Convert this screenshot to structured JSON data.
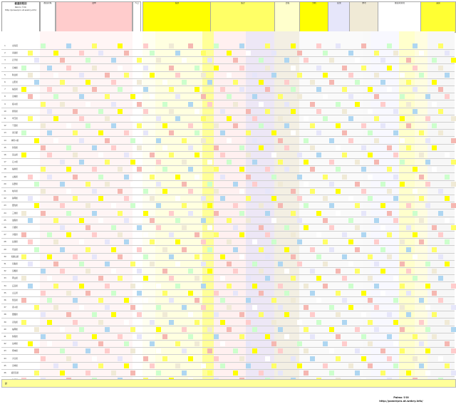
{
  "sheet": {
    "title_block": {
      "title": "都道府県別",
      "author": "Palmo ©Oi",
      "url": "http://powerpro.at.webry.info/"
    },
    "headers": [
      {
        "label": "都道府県",
        "color": "#ffffff"
      },
      {
        "label": "選挙",
        "color": "#ffcccc"
      },
      {
        "label": "人口",
        "color": "#ffffff"
      },
      {
        "label": "投票",
        "color": "#ffff00"
      },
      {
        "label": "集計",
        "color": "#ffff66"
      },
      {
        "label": "比較",
        "color": "#ffffcc"
      },
      {
        "label": "分析",
        "color": "#ffff00"
      },
      {
        "label": "結果",
        "color": "#e6e6fa"
      },
      {
        "label": "参考",
        "color": "#f0ead6"
      },
      {
        "label": "都道府県別",
        "color": "#ffffff"
      },
      {
        "label": "議席",
        "color": "#ffff33"
      }
    ],
    "rows": [
      {
        "no": "1",
        "pref": "北海道"
      },
      {
        "no": "2",
        "pref": "青森県"
      },
      {
        "no": "3",
        "pref": "岩手県"
      },
      {
        "no": "4",
        "pref": "宮城県"
      },
      {
        "no": "5",
        "pref": "秋田県"
      },
      {
        "no": "6",
        "pref": "山形県"
      },
      {
        "no": "7",
        "pref": "福島県"
      },
      {
        "no": "8",
        "pref": "茨城県"
      },
      {
        "no": "9",
        "pref": "栃木県"
      },
      {
        "no": "10",
        "pref": "群馬県"
      },
      {
        "no": "11",
        "pref": "埼玉県"
      },
      {
        "no": "12",
        "pref": "千葉県"
      },
      {
        "no": "13",
        "pref": "東京都"
      },
      {
        "no": "14",
        "pref": "神奈川県"
      },
      {
        "no": "15",
        "pref": "新潟県"
      },
      {
        "no": "16",
        "pref": "富山県"
      },
      {
        "no": "17",
        "pref": "石川県"
      },
      {
        "no": "18",
        "pref": "福井県"
      },
      {
        "no": "19",
        "pref": "山梨県"
      },
      {
        "no": "20",
        "pref": "長野県"
      },
      {
        "no": "21",
        "pref": "岐阜県"
      },
      {
        "no": "22",
        "pref": "静岡県"
      },
      {
        "no": "23",
        "pref": "愛知県"
      },
      {
        "no": "24",
        "pref": "三重県"
      },
      {
        "no": "25",
        "pref": "滋賀県"
      },
      {
        "no": "26",
        "pref": "京都府"
      },
      {
        "no": "27",
        "pref": "大阪府"
      },
      {
        "no": "28",
        "pref": "兵庫県"
      },
      {
        "no": "29",
        "pref": "奈良県"
      },
      {
        "no": "30",
        "pref": "和歌山県"
      },
      {
        "no": "31",
        "pref": "鳥取県"
      },
      {
        "no": "32",
        "pref": "島根県"
      },
      {
        "no": "33",
        "pref": "岡山県"
      },
      {
        "no": "34",
        "pref": "広島県"
      },
      {
        "no": "35",
        "pref": "山口県"
      },
      {
        "no": "36",
        "pref": "徳島県"
      },
      {
        "no": "37",
        "pref": "香川県"
      },
      {
        "no": "38",
        "pref": "愛媛県"
      },
      {
        "no": "39",
        "pref": "高知県"
      },
      {
        "no": "40",
        "pref": "福岡県"
      },
      {
        "no": "41",
        "pref": "佐賀県"
      },
      {
        "no": "42",
        "pref": "長崎県"
      },
      {
        "no": "43",
        "pref": "熊本県"
      },
      {
        "no": "44",
        "pref": "大分県"
      },
      {
        "no": "45",
        "pref": "宮崎県"
      },
      {
        "no": "46",
        "pref": "鹿児島県"
      },
      {
        "no": "47",
        "pref": "沖縄県"
      }
    ],
    "totals_label": "計",
    "palette": [
      "#ffffff",
      "#ffcccc",
      "#ffff66",
      "#ccffcc",
      "#e6e6fa",
      "#f0ead6",
      "#ffff00",
      "#aed6f1",
      "#f5b7b1"
    ],
    "credit": {
      "author": "Palmo ©Oi",
      "url": "http://powerpro.at.webry.info/"
    }
  }
}
